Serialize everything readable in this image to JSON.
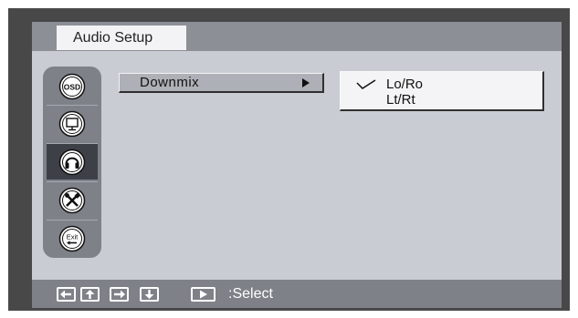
{
  "header": {
    "title": "Audio Setup"
  },
  "sidebar": {
    "icons": [
      {
        "name": "osd-icon",
        "text": "OSD"
      },
      {
        "name": "monitor-icon"
      },
      {
        "name": "headphones-icon",
        "active": true
      },
      {
        "name": "tools-icon"
      },
      {
        "name": "exit-icon",
        "text": "Exit"
      }
    ]
  },
  "menu": {
    "item_label": "Downmix"
  },
  "options": {
    "items": [
      {
        "label": "Lo/Ro",
        "selected": true
      },
      {
        "label": "Lt/Rt",
        "selected": false
      }
    ]
  },
  "footer": {
    "nav_keys": [
      "left-arrow-icon",
      "up-arrow-icon",
      "right-arrow-icon",
      "down-arrow-icon"
    ],
    "select_key": "play-icon",
    "select_label": ":Select"
  },
  "colors": {
    "frame": "#484848",
    "panel": "#c9ccd3",
    "header_band": "#8c8f96",
    "sidebar": "#7e8188",
    "sidebar_active": "#3d4046",
    "menu_item": "#adb0b6",
    "options_box": "#f4f4f6"
  }
}
